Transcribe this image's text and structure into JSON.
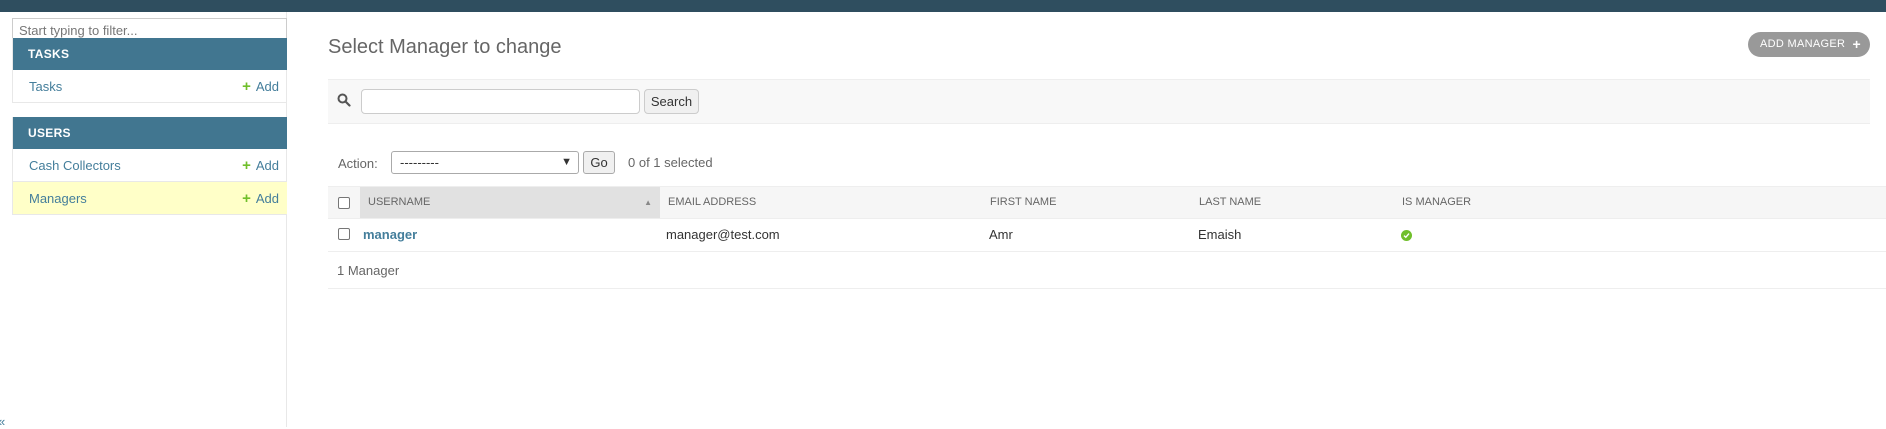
{
  "sidebar": {
    "filter_placeholder": "Start typing to filter...",
    "apps": [
      {
        "name": "Tasks",
        "models": [
          {
            "label": "Tasks",
            "add_label": "Add"
          }
        ]
      },
      {
        "name": "Users",
        "models": [
          {
            "label": "Cash Collectors",
            "add_label": "Add"
          },
          {
            "label": "Managers",
            "add_label": "Add",
            "current": true
          }
        ]
      }
    ],
    "collapse_symbol": "«"
  },
  "main": {
    "title": "Select Manager to change",
    "add_button_label": "Add Manager",
    "search": {
      "placeholder": "",
      "button_label": "Search"
    },
    "actions": {
      "label": "Action:",
      "selected_option": "---------",
      "go_label": "Go",
      "selection_count": "0 of 1 selected"
    },
    "table": {
      "columns": [
        "Username",
        "Email address",
        "First name",
        "Last name",
        "Is manager"
      ],
      "sorted_column": "Username",
      "rows": [
        {
          "username": "manager",
          "email": "manager@test.com",
          "first_name": "Amr",
          "last_name": "Emaish",
          "is_manager": true
        }
      ]
    },
    "paginator": "1 Manager"
  },
  "colors": {
    "header": "#417690",
    "topbar": "#2f4e5f",
    "link": "#447e9b",
    "add_green": "#70bf2b",
    "current_row": "#ffffc8"
  },
  "icons": {
    "search": "search-icon",
    "add": "plus-icon",
    "yes": "check-circle-icon",
    "sort": "sort-ascending-icon"
  }
}
